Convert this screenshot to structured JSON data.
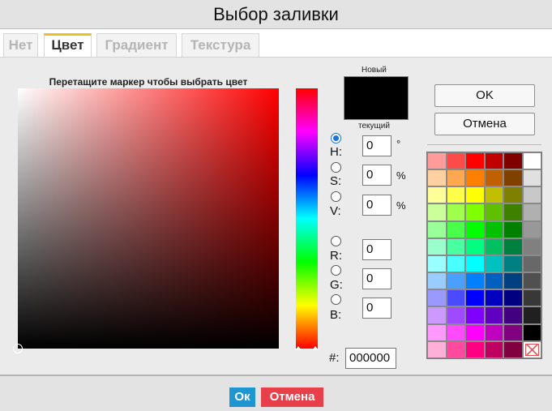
{
  "window": {
    "title": "Выбор заливки"
  },
  "tabs": [
    {
      "label": "Нет"
    },
    {
      "label": "Цвет"
    },
    {
      "label": "Градиент"
    },
    {
      "label": "Текстура"
    }
  ],
  "picker": {
    "hint": "Перетащите маркер чтобы выбрать цвет",
    "new_label": "Новый",
    "current_label": "текущий",
    "new_color": "#000000",
    "hue_deg": 0
  },
  "fields": {
    "h": {
      "label": "H:",
      "value": "0",
      "unit": "°"
    },
    "s": {
      "label": "S:",
      "value": "0",
      "unit": "%"
    },
    "v": {
      "label": "V:",
      "value": "0",
      "unit": "%"
    },
    "r": {
      "label": "R:",
      "value": "0"
    },
    "g": {
      "label": "G:",
      "value": "0"
    },
    "b": {
      "label": "B:",
      "value": "0"
    },
    "hex": {
      "label": "#:",
      "value": "000000"
    }
  },
  "buttons": {
    "ok": "OK",
    "cancel": "Отмена"
  },
  "palette": [
    [
      "#ff9b9b",
      "#ff4a4a",
      "#ff0000",
      "#c00000",
      "#800000",
      "#ffffff"
    ],
    [
      "#ffd0a0",
      "#ffa852",
      "#ff8000",
      "#c06000",
      "#804000",
      "#e0e0e0"
    ],
    [
      "#ffff99",
      "#ffff4a",
      "#ffff00",
      "#c0c000",
      "#808000",
      "#c8c8c8"
    ],
    [
      "#ccff99",
      "#a0ff4a",
      "#80ff00",
      "#60c000",
      "#408000",
      "#b0b0b0"
    ],
    [
      "#99ff99",
      "#4aff4a",
      "#00ff00",
      "#00c000",
      "#008000",
      "#989898"
    ],
    [
      "#99ffcc",
      "#4affa0",
      "#00ff80",
      "#00c060",
      "#008040",
      "#808080"
    ],
    [
      "#99ffff",
      "#4affff",
      "#00ffff",
      "#00c0c0",
      "#008080",
      "#686868"
    ],
    [
      "#99ccff",
      "#4aa0ff",
      "#0080ff",
      "#0060c0",
      "#004080",
      "#505050"
    ],
    [
      "#9999ff",
      "#4a4aff",
      "#0000ff",
      "#0000c0",
      "#000080",
      "#383838"
    ],
    [
      "#cc99ff",
      "#a04aff",
      "#8000ff",
      "#6000c0",
      "#400080",
      "#202020"
    ],
    [
      "#ff99ff",
      "#ff4aff",
      "#ff00ff",
      "#c000c0",
      "#800080",
      "#000000"
    ],
    [
      "#ffb0d8",
      "#ff4aa0",
      "#ff0080",
      "#c00060",
      "#800040",
      "none"
    ]
  ],
  "footer": {
    "ok": "Ок",
    "cancel": "Отмена",
    "ok_color": "#1e96d2",
    "cancel_color": "#e8404a"
  }
}
